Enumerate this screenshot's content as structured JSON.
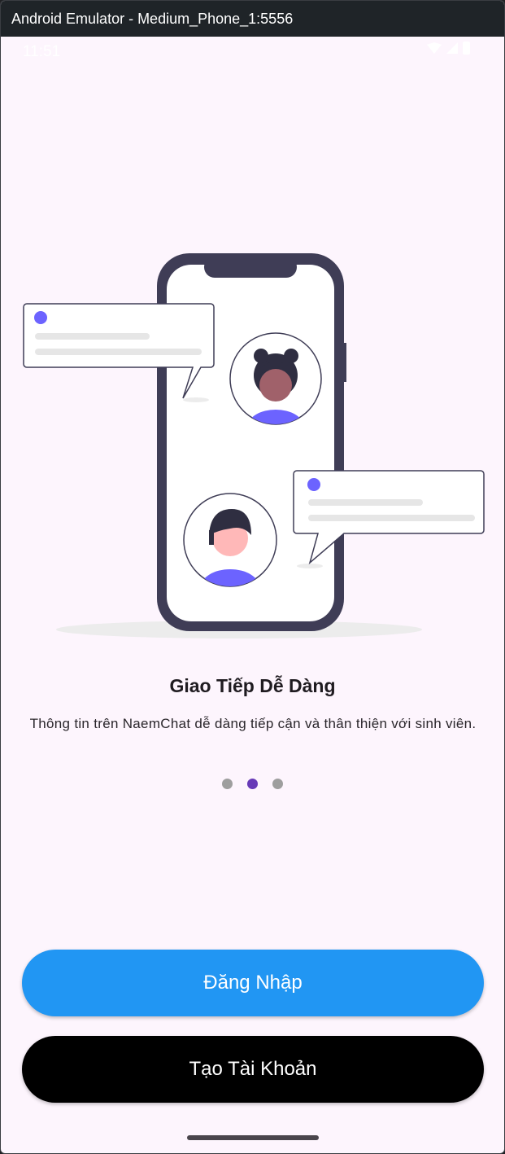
{
  "window": {
    "title": "Android Emulator - Medium_Phone_1:5556"
  },
  "status_bar": {
    "time": "11:51"
  },
  "onboarding": {
    "title": "Giao Tiếp Dễ Dàng",
    "description": "Thông tin trên NaemChat dễ dàng tiếp cận và thân thiện với sinh viên.",
    "page_count": 3,
    "active_page": 2
  },
  "actions": {
    "login_label": "Đăng Nhập",
    "register_label": "Tạo Tài Khoản"
  },
  "colors": {
    "background": "#fdf5fd",
    "primary_button": "#2196f3",
    "secondary_button": "#000000",
    "active_dot": "#673ab7",
    "inactive_dot": "#9e9e9e",
    "illustration_accent": "#6c63ff",
    "phone_frame": "#3f3d56"
  }
}
